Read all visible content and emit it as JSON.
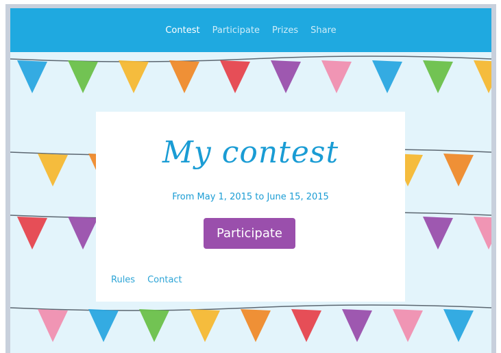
{
  "nav": {
    "items": [
      {
        "label": "Contest",
        "active": true
      },
      {
        "label": "Participate",
        "active": false
      },
      {
        "label": "Prizes",
        "active": false
      },
      {
        "label": "Share",
        "active": false
      }
    ]
  },
  "card": {
    "title": "My contest",
    "dates": "From May 1, 2015 to June 15, 2015",
    "cta_label": "Participate",
    "links": [
      "Rules",
      "Contact"
    ]
  },
  "colors": {
    "nav_bg": "#1fa9e0",
    "accent": "#1a9cd4",
    "cta_bg": "#9a4fac",
    "page_bg": "#e3f4fb",
    "flags": [
      "#2aa6e0",
      "#6cc04a",
      "#f5b833",
      "#ef8a2b",
      "#e6454e",
      "#9a4fac",
      "#f08fb0"
    ]
  }
}
